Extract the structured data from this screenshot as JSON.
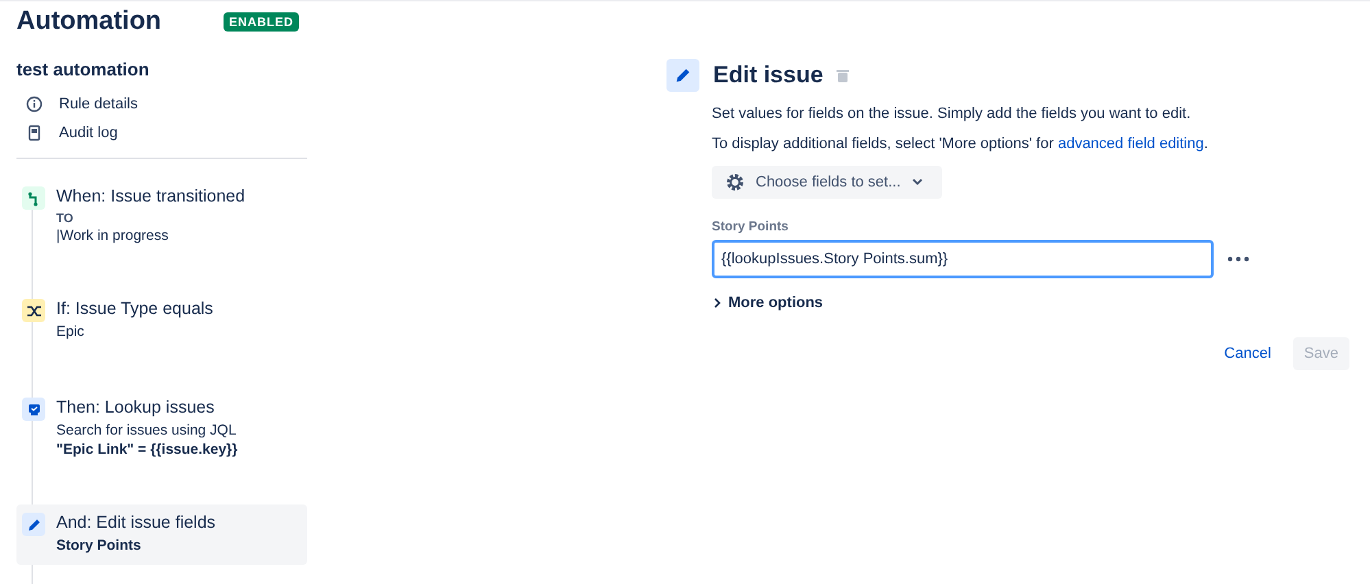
{
  "header": {
    "title": "Automation",
    "status": {
      "label": "ENABLED",
      "enabled": true
    }
  },
  "rule": {
    "name": "test automation",
    "links": [
      {
        "kind": "info",
        "label": "Rule details"
      },
      {
        "kind": "log",
        "label": "Audit log"
      }
    ]
  },
  "steps": [
    {
      "kind": "trigger",
      "title": "When: Issue transitioned",
      "selected": false,
      "lines": [
        {
          "text": "TO",
          "kind": "caption"
        },
        {
          "text": "|Work in progress",
          "kind": "plain"
        }
      ]
    },
    {
      "kind": "condition",
      "title": "If: Issue Type equals",
      "selected": false,
      "lines": [
        {
          "text": "Epic",
          "kind": "plain"
        }
      ]
    },
    {
      "kind": "lookup",
      "title": "Then: Lookup issues",
      "selected": false,
      "lines": [
        {
          "text": "Search for issues using JQL",
          "kind": "plain"
        },
        {
          "text": "\"Epic Link\" = {{issue.key}}",
          "kind": "bold"
        }
      ]
    },
    {
      "kind": "edit",
      "title": "And: Edit issue fields",
      "selected": true,
      "lines": [
        {
          "text": "Story Points",
          "kind": "bold"
        }
      ]
    }
  ],
  "editor": {
    "title": "Edit issue",
    "description": "Set values for fields on the issue. Simply add the fields you want to edit.",
    "hint": {
      "before": "To display additional fields, select 'More options' for ",
      "link": "advanced field editing",
      "after": "."
    },
    "chooser": "Choose fields to set...",
    "field": {
      "label": "Story Points",
      "value": "{{lookupIssues.Story Points.sum}}",
      "focused": true
    },
    "more_options": {
      "label": "More options",
      "expanded": false
    },
    "buttons": [
      {
        "kind": "cancel",
        "label": "Cancel",
        "disabled": false
      },
      {
        "kind": "save",
        "label": "Save",
        "disabled": true
      }
    ]
  }
}
